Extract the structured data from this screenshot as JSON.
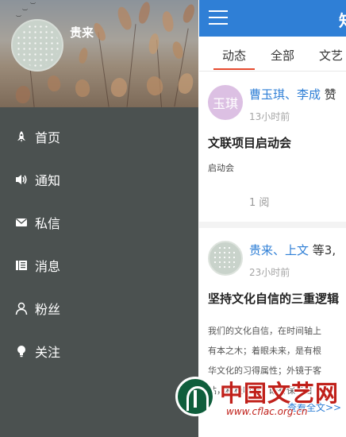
{
  "drawer": {
    "user_name": "贵来",
    "menu": [
      {
        "label": "首页",
        "icon": "rocket-icon"
      },
      {
        "label": "通知",
        "icon": "speaker-icon"
      },
      {
        "label": "私信",
        "icon": "envelope-icon"
      },
      {
        "label": "消息",
        "icon": "news-icon"
      },
      {
        "label": "粉丝",
        "icon": "person-icon"
      },
      {
        "label": "关注",
        "icon": "lightbulb-icon"
      }
    ]
  },
  "topbar": {
    "title": "知",
    "menu_icon": "hamburger-icon",
    "color": "#2f7fd6"
  },
  "tabs": {
    "items": [
      "动态",
      "全部",
      "文艺"
    ],
    "active_index": 0,
    "active_color": "#e64a2e"
  },
  "feed": [
    {
      "avatar_text": "玉琪",
      "names": "曹玉琪、李成",
      "names_suffix": "赞",
      "time": "13小时前",
      "title": "文联项目启动会",
      "subtitle": "启动会",
      "reads": "1 阅"
    },
    {
      "names": "贵来、上文",
      "names_suffix": "等3,",
      "time": "23小时前",
      "title": "坚持文化自信的三重逻辑",
      "excerpt_lines": [
        "我们的文化自信，在时间轴上",
        "有本之木；着眼未来，是有根",
        "华文化的习得属性；外镜于客",
        "钴，积极吸取，既有保与目"
      ],
      "read_more": "查看全文>>"
    }
  ],
  "watermark": {
    "text": "中国文艺网",
    "url": "www.cflac.org.cn"
  }
}
